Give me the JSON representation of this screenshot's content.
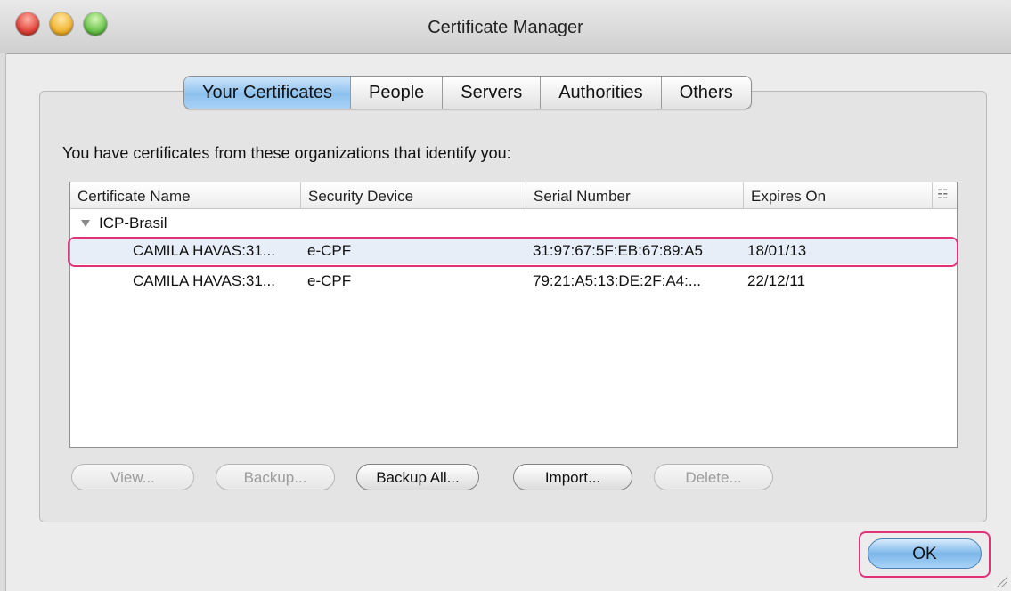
{
  "window": {
    "title": "Certificate Manager"
  },
  "tabs": [
    {
      "label": "Your Certificates",
      "active": true
    },
    {
      "label": "People"
    },
    {
      "label": "Servers"
    },
    {
      "label": "Authorities"
    },
    {
      "label": "Others"
    }
  ],
  "intro_text": "You have certificates from these organizations that identify you:",
  "table": {
    "columns": [
      "Certificate Name",
      "Security Device",
      "Serial Number",
      "Expires On"
    ],
    "group": "ICP-Brasil",
    "rows": [
      {
        "name": "CAMILA HAVAS:31...",
        "device": "e-CPF",
        "serial": "31:97:67:5F:EB:67:89:A5",
        "expires": "18/01/13",
        "selected": true
      },
      {
        "name": "CAMILA HAVAS:31...",
        "device": "e-CPF",
        "serial": "79:21:A5:13:DE:2F:A4:...",
        "expires": "22/12/11"
      }
    ]
  },
  "buttons": {
    "view": "View...",
    "backup": "Backup...",
    "backup_all": "Backup All...",
    "import": "Import...",
    "delete": "Delete...",
    "ok": "OK"
  },
  "colors": {
    "highlight": "#e0337b",
    "active_tab": "#8dc1ee"
  }
}
